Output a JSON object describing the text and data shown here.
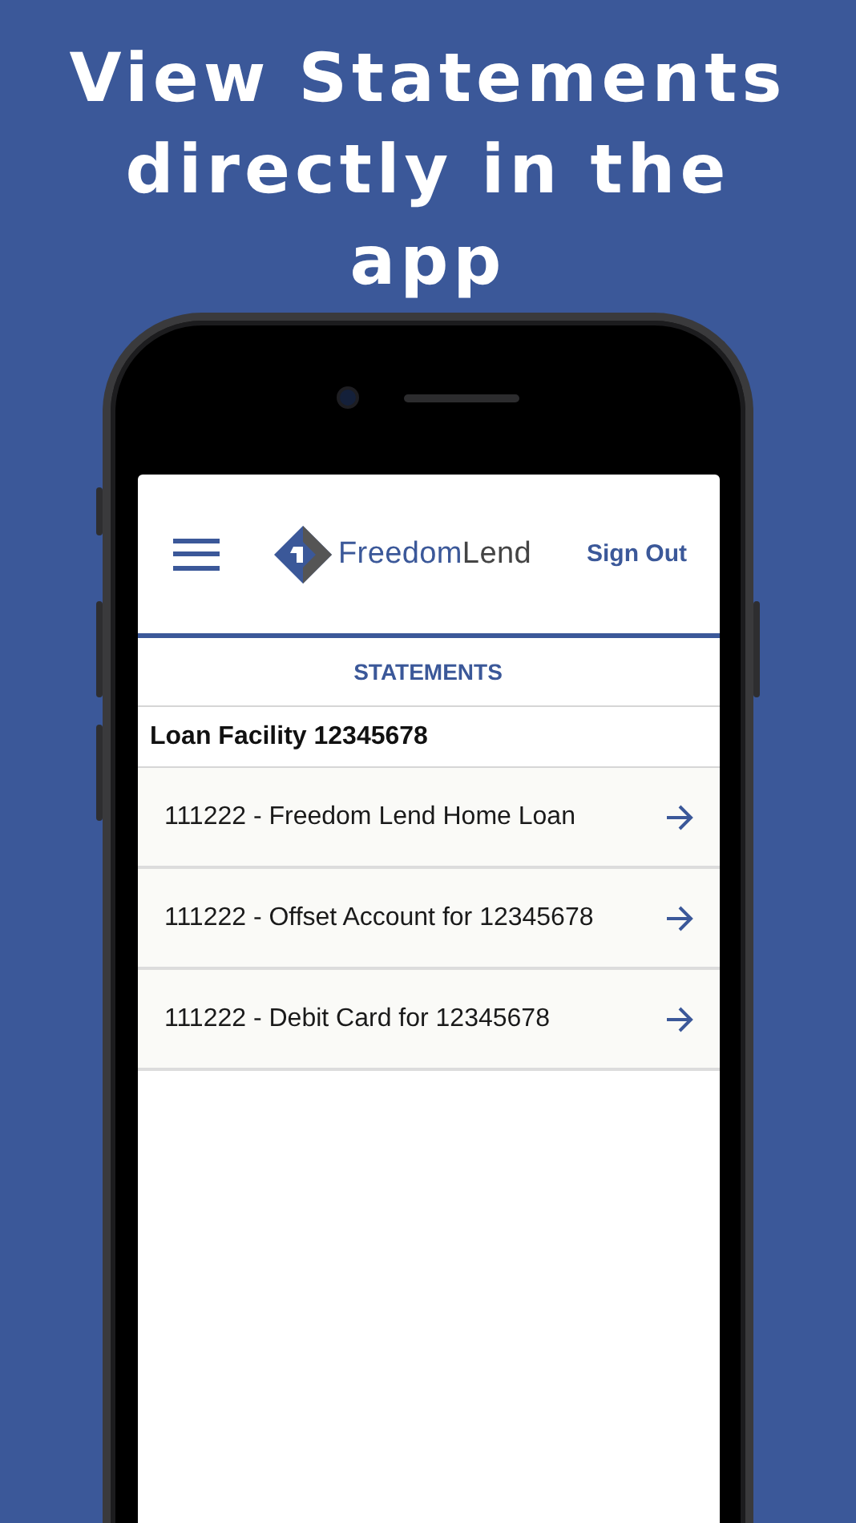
{
  "headline": "View Statements directly in the app",
  "app": {
    "logo": {
      "first": "Freedom",
      "second": "Lend"
    },
    "sign_out": "Sign Out",
    "section_title": "STATEMENTS",
    "group_title": "Loan Facility 12345678",
    "items": [
      {
        "label": "111222 - Freedom Lend Home Loan"
      },
      {
        "label": "111222 - Offset Account for 12345678"
      },
      {
        "label": "111222 - Debit Card for 12345678"
      }
    ]
  }
}
